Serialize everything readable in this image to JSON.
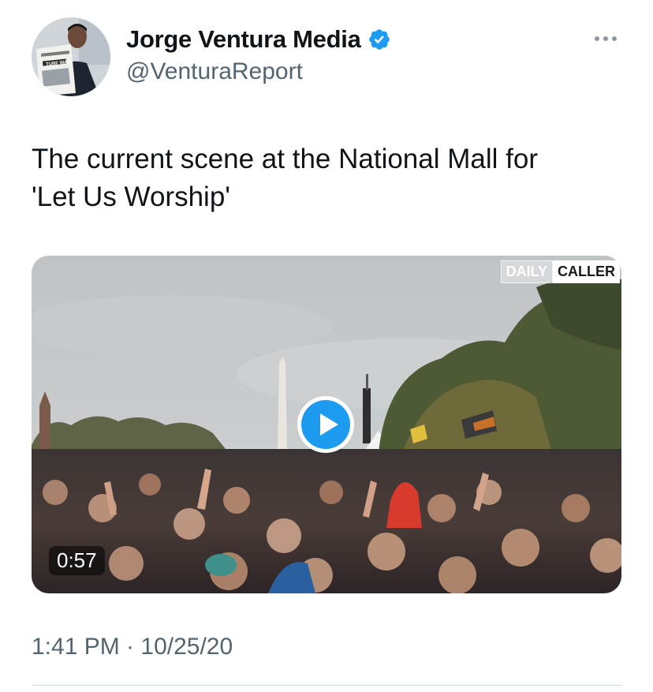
{
  "tweet": {
    "author": {
      "display_name": "Jorge Ventura Media",
      "handle": "@VenturaReport",
      "verified": true,
      "avatar_newspaper_headline": "TURF WAR"
    },
    "more_icon": "more-horizontal-icon",
    "text_line1": "The current scene at the National Mall for",
    "text_line2": "'Let Us Worship'",
    "media": {
      "type": "video",
      "watermark_left": "DAILY",
      "watermark_right": "CALLER",
      "duration": "0:57",
      "play_icon": "play-icon"
    },
    "timestamp": "1:41 PM · 10/25/20"
  },
  "colors": {
    "verified_blue": "#1d9bf0",
    "secondary_text": "#536471",
    "primary_text": "#0f1419",
    "divider": "#cfd9de"
  }
}
